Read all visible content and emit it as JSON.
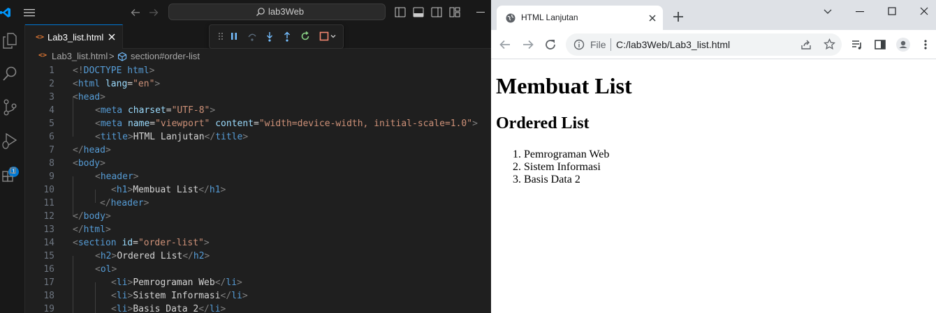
{
  "vscode": {
    "command_center": {
      "label": "lab3Web"
    },
    "debug_badge": "1",
    "tab": {
      "label": "Lab3_list.html",
      "icon": "html-icon"
    },
    "breadcrumb": {
      "file": "Lab3_list.html",
      "separator": ">",
      "symbol": "section#order-list"
    },
    "lines": [
      {
        "n": "1"
      },
      {
        "n": "2"
      },
      {
        "n": "3"
      },
      {
        "n": "4"
      },
      {
        "n": "5"
      },
      {
        "n": "6"
      },
      {
        "n": "7"
      },
      {
        "n": "8"
      },
      {
        "n": "9"
      },
      {
        "n": "10"
      },
      {
        "n": "11"
      },
      {
        "n": "12"
      },
      {
        "n": "13"
      },
      {
        "n": "14"
      },
      {
        "n": "15"
      },
      {
        "n": "16"
      },
      {
        "n": "17"
      },
      {
        "n": "18"
      },
      {
        "n": "19"
      }
    ],
    "code": {
      "l1": {
        "a": "<!",
        "b": "DOCTYPE",
        "c": " html",
        "d": ">"
      },
      "l2": {
        "a": "<",
        "b": "html",
        "c": " lang",
        "d": "=",
        "e": "\"en\"",
        "f": ">"
      },
      "l3": {
        "a": "<",
        "b": "head",
        "c": ">"
      },
      "l4": {
        "a": "<",
        "b": "meta",
        "c": " charset",
        "d": "=",
        "e": "\"UTF-8\"",
        "f": ">"
      },
      "l5": {
        "a": "<",
        "b": "meta",
        "c": " name",
        "d": "=",
        "e": "\"viewport\"",
        "f": " content",
        "g": "=",
        "h": "\"width=device-width, initial-scale=1.0\"",
        "i": ">"
      },
      "l6": {
        "a": "<",
        "b": "title",
        "c": ">",
        "d": "HTML Lanjutan",
        "e": "</",
        "f": "title",
        "g": ">"
      },
      "l7": {
        "a": "</",
        "b": "head",
        "c": ">"
      },
      "l8": {
        "a": "<",
        "b": "body",
        "c": ">"
      },
      "l9": {
        "a": "<",
        "b": "header",
        "c": ">"
      },
      "l10": {
        "a": "<",
        "b": "h1",
        "c": ">",
        "d": "Membuat List",
        "e": "</",
        "f": "h1",
        "g": ">"
      },
      "l11": {
        "a": "</",
        "b": "header",
        "c": ">"
      },
      "l12": {
        "a": "</",
        "b": "body",
        "c": ">"
      },
      "l13": {
        "a": "</",
        "b": "html",
        "c": ">"
      },
      "l14": {
        "a": "<",
        "b": "section",
        "c": " id",
        "d": "=",
        "e": "\"order-list\"",
        "f": ">"
      },
      "l15": {
        "a": "<",
        "b": "h2",
        "c": ">",
        "d": "Ordered List",
        "e": "</",
        "f": "h2",
        "g": ">"
      },
      "l16": {
        "a": "<",
        "b": "ol",
        "c": ">"
      },
      "l17": {
        "a": "<",
        "b": "li",
        "c": ">",
        "d": "Pemrograman Web",
        "e": "</",
        "f": "li",
        "g": ">"
      },
      "l18": {
        "a": "<",
        "b": "li",
        "c": ">",
        "d": "Sistem Informasi",
        "e": "</",
        "f": "li",
        "g": ">"
      },
      "l19": {
        "a": "<",
        "b": "li",
        "c": ">",
        "d": "Basis Data 2",
        "e": "</",
        "f": "li",
        "g": ">"
      }
    },
    "colors": {
      "accent": "#0078d4",
      "tag": "#569cd6",
      "attr": "#9cdcfe",
      "string": "#ce9178"
    }
  },
  "chrome": {
    "tab_title": "HTML Lanjutan",
    "omnibox": {
      "scheme_label": "File",
      "url": "C:/lab3Web/Lab3_list.html"
    },
    "page": {
      "h1": "Membuat List",
      "h2": "Ordered List",
      "list": [
        {
          "num": "1.",
          "text": "Pemrograman Web"
        },
        {
          "num": "2.",
          "text": "Sistem Informasi"
        },
        {
          "num": "3.",
          "text": "Basis Data 2"
        }
      ]
    }
  }
}
